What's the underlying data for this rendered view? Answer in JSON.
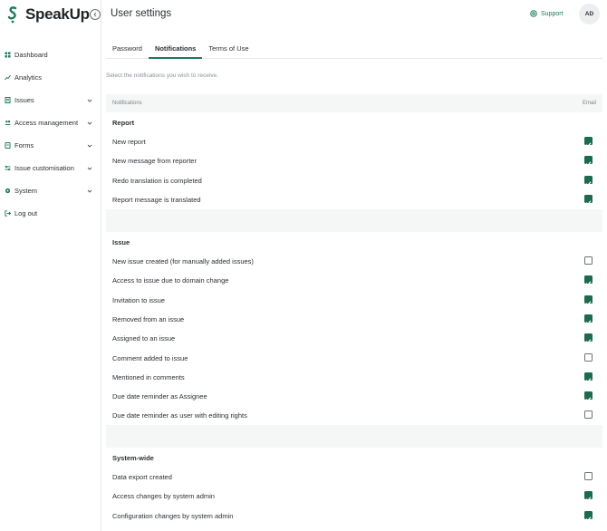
{
  "brand": {
    "name": "SpeakUp"
  },
  "sidebar": {
    "items": [
      {
        "label": "Dashboard",
        "icon": "grid-icon",
        "chevron": false
      },
      {
        "label": "Analytics",
        "icon": "chart-icon",
        "chevron": false
      },
      {
        "label": "Issues",
        "icon": "document-icon",
        "chevron": true
      },
      {
        "label": "Access management",
        "icon": "users-icon",
        "chevron": true
      },
      {
        "label": "Forms",
        "icon": "form-icon",
        "chevron": true
      },
      {
        "label": "Issue customisation",
        "icon": "sliders-icon",
        "chevron": true
      },
      {
        "label": "System",
        "icon": "gear-icon",
        "chevron": true
      },
      {
        "label": "Log out",
        "icon": "logout-icon",
        "chevron": false
      }
    ]
  },
  "header": {
    "title": "User settings",
    "support_label": "Support",
    "avatar_initials": "AD"
  },
  "tabs": [
    {
      "label": "Password",
      "active": false
    },
    {
      "label": "Notifications",
      "active": true
    },
    {
      "label": "Terms of Use",
      "active": false
    }
  ],
  "hint": "Select the notifications you wish to receive.",
  "table": {
    "col_notifications": "Notifications",
    "col_email": "Email"
  },
  "sections": [
    {
      "title": "Report",
      "rows": [
        {
          "label": "New report",
          "checked": true
        },
        {
          "label": "New message from reporter",
          "checked": true
        },
        {
          "label": "Redo translation is completed",
          "checked": true
        },
        {
          "label": "Report message is translated",
          "checked": true
        }
      ]
    },
    {
      "title": "Issue",
      "rows": [
        {
          "label": "New issue created (for manually added issues)",
          "checked": false
        },
        {
          "label": "Access to issue due to domain change",
          "checked": true
        },
        {
          "label": "Invitation to issue",
          "checked": true
        },
        {
          "label": "Removed from an issue",
          "checked": true
        },
        {
          "label": "Assigned to an issue",
          "checked": true
        },
        {
          "label": "Comment added to issue",
          "checked": false
        },
        {
          "label": "Mentioned in comments",
          "checked": true
        },
        {
          "label": "Due date reminder as Assignee",
          "checked": true
        },
        {
          "label": "Due date reminder as user with editing rights",
          "checked": false
        }
      ]
    },
    {
      "title": "System-wide",
      "rows": [
        {
          "label": "Data export created",
          "checked": false
        },
        {
          "label": "Access changes by system admin",
          "checked": true
        },
        {
          "label": "Configuration changes by system admin",
          "checked": true
        }
      ]
    }
  ],
  "colors": {
    "accent": "#1e7a5c",
    "checkbox_on": "#1c6b4e",
    "panel_bg": "#f5f6f6"
  }
}
